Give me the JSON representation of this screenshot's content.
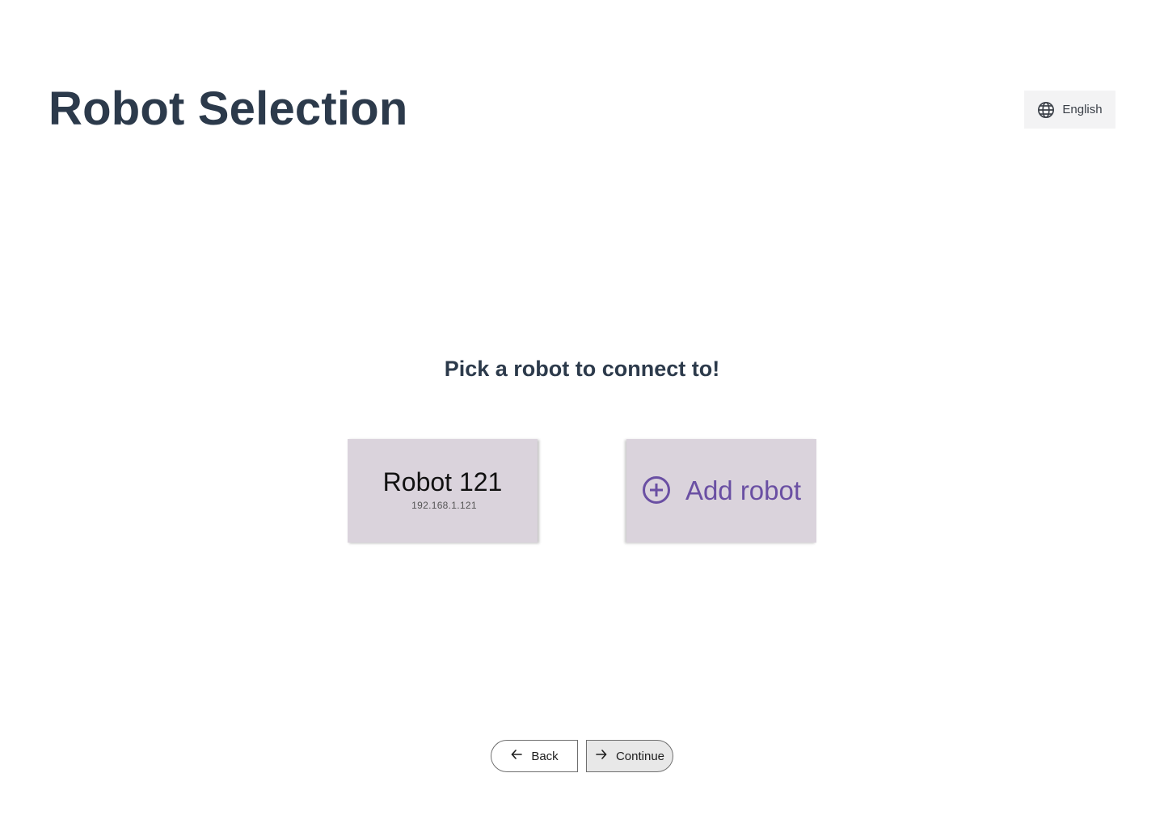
{
  "header": {
    "title": "Robot Selection",
    "language_label": "English",
    "language_icon": "globe-icon"
  },
  "main": {
    "prompt": "Pick a robot to connect to!",
    "robots": [
      {
        "name": "Robot 121",
        "ip": "192.168.1.121"
      }
    ],
    "add_robot": {
      "label": "Add robot",
      "icon": "plus-circle-icon"
    }
  },
  "footer": {
    "back_label": "Back",
    "back_icon": "arrow-left-icon",
    "continue_label": "Continue",
    "continue_icon": "arrow-right-icon"
  },
  "colors": {
    "title": "#2c3a4b",
    "card_background": "#dad3dc",
    "accent": "#6a4fa3"
  }
}
